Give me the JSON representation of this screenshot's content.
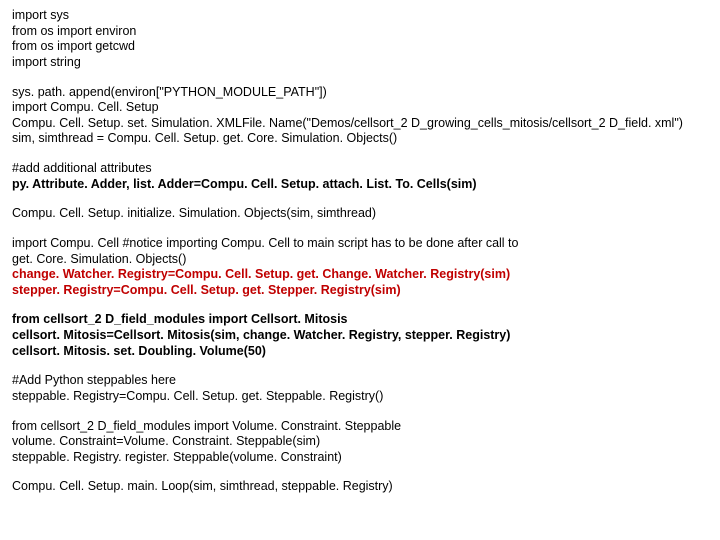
{
  "lines": [
    {
      "text": "import sys",
      "bold": false,
      "red": false
    },
    {
      "text": "from os import environ",
      "bold": false,
      "red": false
    },
    {
      "text": "from os import getcwd",
      "bold": false,
      "red": false
    },
    {
      "text": "import string",
      "bold": false,
      "red": false
    },
    {
      "gap": true
    },
    {
      "text": "sys. path. append(environ[\"PYTHON_MODULE_PATH\"])",
      "bold": false,
      "red": false
    },
    {
      "text": "import Compu. Cell. Setup",
      "bold": false,
      "red": false
    },
    {
      "text": "Compu. Cell. Setup. set. Simulation. XMLFile. Name(\"Demos/cellsort_2 D_growing_cells_mitosis/cellsort_2 D_field. xml\")",
      "bold": false,
      "red": false
    },
    {
      "text": "sim, simthread = Compu. Cell. Setup. get. Core. Simulation. Objects()",
      "bold": false,
      "red": false
    },
    {
      "gap": true
    },
    {
      "text": "#add additional attributes",
      "bold": false,
      "red": false
    },
    {
      "text": "py. Attribute. Adder, list. Adder=Compu. Cell. Setup. attach. List. To. Cells(sim)",
      "bold": true,
      "red": false
    },
    {
      "gap": true
    },
    {
      "text": "Compu. Cell. Setup. initialize. Simulation. Objects(sim, simthread)",
      "bold": false,
      "red": false
    },
    {
      "gap": true
    },
    {
      "text": "import Compu. Cell #notice importing Compu. Cell to main script has to be done after call to",
      "bold": false,
      "red": false
    },
    {
      "text": "get. Core. Simulation. Objects()",
      "bold": false,
      "red": false
    },
    {
      "text": "change. Watcher. Registry=Compu. Cell. Setup. get. Change. Watcher. Registry(sim)",
      "bold": true,
      "red": true
    },
    {
      "text": "stepper. Registry=Compu. Cell. Setup. get. Stepper. Registry(sim)",
      "bold": true,
      "red": true
    },
    {
      "gap": true
    },
    {
      "text": "from cellsort_2 D_field_modules import Cellsort. Mitosis",
      "bold": true,
      "red": false
    },
    {
      "text": "cellsort. Mitosis=Cellsort. Mitosis(sim, change. Watcher. Registry, stepper. Registry)",
      "bold": true,
      "red": false
    },
    {
      "text": "cellsort. Mitosis. set. Doubling. Volume(50)",
      "bold": true,
      "red": false
    },
    {
      "gap": true
    },
    {
      "text": "#Add Python steppables here",
      "bold": false,
      "red": false
    },
    {
      "text": "steppable. Registry=Compu. Cell. Setup. get. Steppable. Registry()",
      "bold": false,
      "red": false
    },
    {
      "gap": true
    },
    {
      "text": "from cellsort_2 D_field_modules import Volume. Constraint. Steppable",
      "bold": false,
      "red": false
    },
    {
      "text": "volume. Constraint=Volume. Constraint. Steppable(sim)",
      "bold": false,
      "red": false
    },
    {
      "text": "steppable. Registry. register. Steppable(volume. Constraint)",
      "bold": false,
      "red": false
    },
    {
      "gap": true
    },
    {
      "text": "Compu. Cell. Setup. main. Loop(sim, simthread, steppable. Registry)",
      "bold": false,
      "red": false
    }
  ]
}
